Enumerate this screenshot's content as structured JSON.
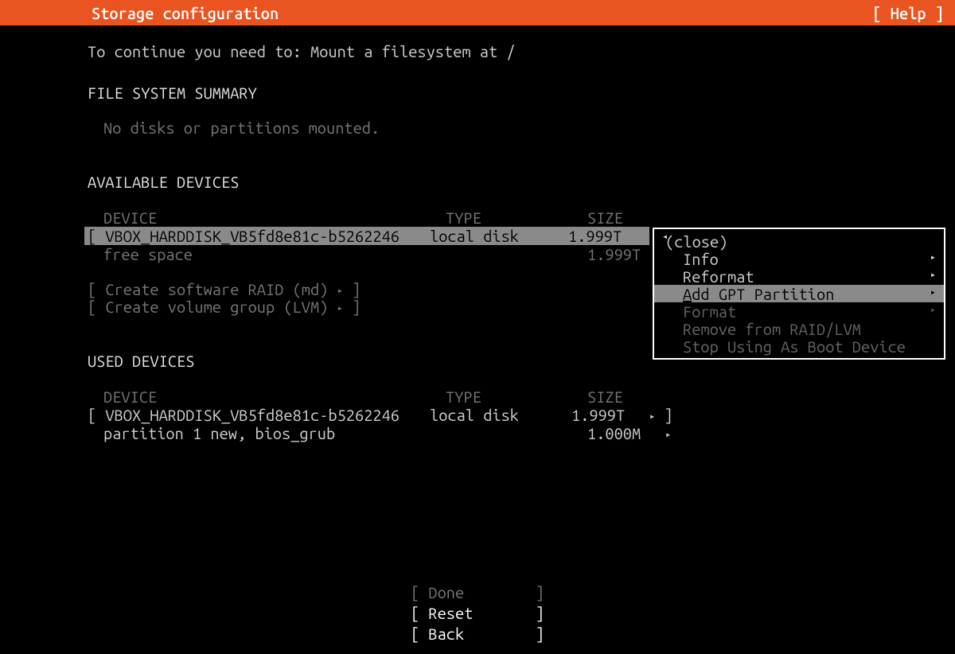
{
  "header": {
    "title": "Storage configuration",
    "help": "[ Help ]"
  },
  "instruction": "To continue you need to: Mount a filesystem at /",
  "fs_summary": {
    "heading": "FILE SYSTEM SUMMARY",
    "empty": "No disks or partitions mounted."
  },
  "available": {
    "heading": "AVAILABLE DEVICES",
    "cols": {
      "device": "DEVICE",
      "type": "TYPE",
      "size": "SIZE"
    },
    "selected": {
      "open": "[ ",
      "name": "VBOX_HARDDISK_VB5fd8e81c-b5262246",
      "type": "local disk",
      "size": "1.999T"
    },
    "free": {
      "label": "free space",
      "size": "1.999T"
    },
    "actions": {
      "raid": "[ Create software RAID (md) ",
      "raid_tail": " ]",
      "lvm": "[ Create volume group (LVM) ",
      "lvm_tail": " ]"
    }
  },
  "popup": {
    "close": "(close)",
    "info": "Info",
    "reformat": "Reformat",
    "add_rest": "dd GPT Partition",
    "format": "Format",
    "remove": "Remove from RAID/LVM",
    "stop": "Stop Using As Boot Device"
  },
  "used": {
    "heading": "USED DEVICES",
    "cols": {
      "device": "DEVICE",
      "type": "TYPE",
      "size": "SIZE"
    },
    "disk": {
      "open": "[ ",
      "name": "VBOX_HARDDISK_VB5fd8e81c-b5262246",
      "type": "local disk",
      "size": "1.999T",
      "tail": " ]"
    },
    "part": {
      "label": "partition 1  new, bios_grub",
      "size": "1.000M"
    }
  },
  "buttons": {
    "done": "[ Done        ]",
    "reset": "[ Reset       ]",
    "back": "[ Back        ]"
  },
  "glyph": {
    "tri_r": "▸",
    "tri_l": "◂"
  }
}
